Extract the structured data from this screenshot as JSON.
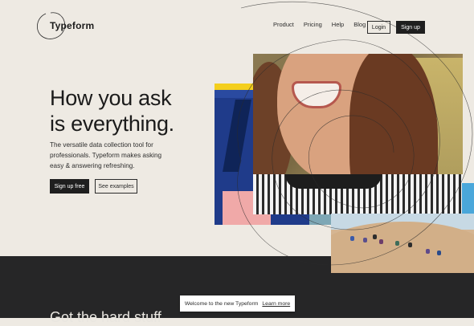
{
  "header": {
    "logo_text": "Typeform",
    "nav": [
      "Product",
      "Pricing",
      "Help",
      "Blog"
    ],
    "login_label": "Login",
    "signup_label": "Sign up"
  },
  "hero": {
    "headline_line1": "How you ask",
    "headline_line2": "is everything.",
    "subtext": "The versatile data collection tool for professionals. Typeform makes asking easy & answering refreshing.",
    "primary_cta": "Sign up free",
    "secondary_cta": "See examples"
  },
  "notice": {
    "text": "Welcome to the new Typeform",
    "link": "Learn more"
  },
  "dark_section": {
    "heading_partial": "Got the hard stuff"
  },
  "colors": {
    "background": "#EEEAE3",
    "dark": "#262627",
    "button_dark": "#1F1F1F",
    "art_yellow": "#F4CF1D",
    "art_blue": "#1F3B8A",
    "art_pink": "#F0A9A8",
    "accent_blue": "#4AA7DA"
  }
}
